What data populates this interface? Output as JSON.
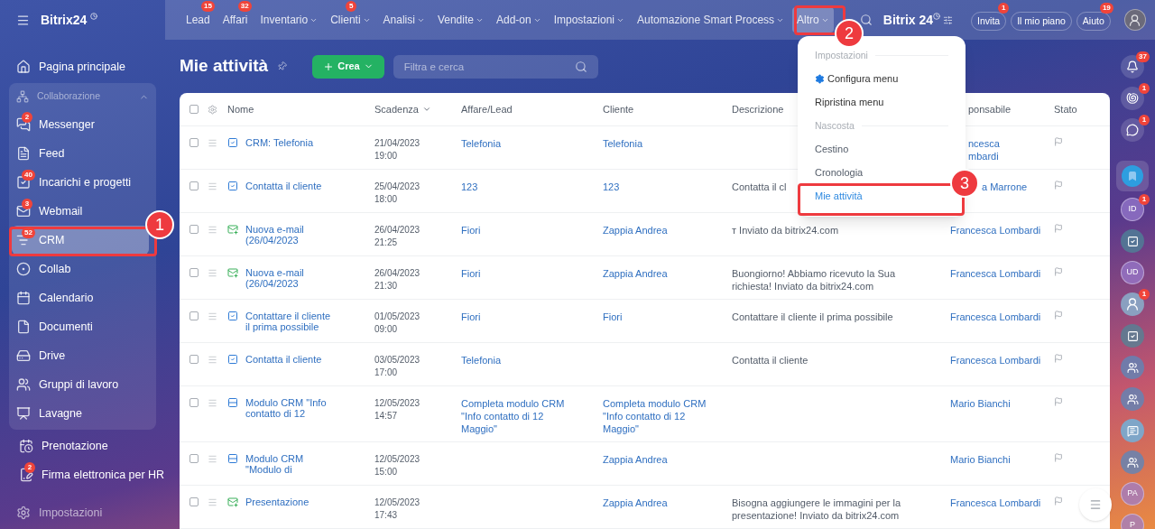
{
  "logo": "Bitrix24",
  "top_nav": [
    {
      "label": "Lead",
      "badge": "15",
      "dropdown": false,
      "selected": false
    },
    {
      "label": "Affari",
      "badge": "32",
      "dropdown": false,
      "selected": false
    },
    {
      "label": "Inventario",
      "dropdown": true,
      "selected": false
    },
    {
      "label": "Clienti",
      "badge": "5",
      "dropdown": true,
      "selected": false
    },
    {
      "label": "Analisi",
      "dropdown": true,
      "selected": false
    },
    {
      "label": "Vendite",
      "dropdown": true,
      "selected": false
    },
    {
      "label": "Add-on",
      "dropdown": true,
      "selected": false
    },
    {
      "label": "Impostazioni",
      "dropdown": true,
      "selected": false
    },
    {
      "label": "Automazione Smart Process",
      "dropdown": true,
      "selected": false
    },
    {
      "label": "Altro",
      "dropdown": true,
      "selected": true
    }
  ],
  "header_right": {
    "brand": "Bitrix 24",
    "buttons": [
      {
        "label": "Invita",
        "badge": "1"
      },
      {
        "label": "Il mio piano"
      },
      {
        "label": "Aiuto",
        "badge": "19"
      }
    ]
  },
  "sidebar": {
    "top_item": "Pagina principale",
    "group": {
      "label": "Collaborazione",
      "expanded": true,
      "items": [
        {
          "label": "Messenger",
          "badge": "2",
          "selected": false
        },
        {
          "label": "Feed",
          "selected": false
        },
        {
          "label": "Incarichi e progetti",
          "badge": "40",
          "selected": false
        },
        {
          "label": "Webmail",
          "badge": "3",
          "selected": false
        },
        {
          "label": "CRM",
          "badge": "52",
          "selected": true
        },
        {
          "label": "Collab",
          "selected": false
        },
        {
          "label": "Calendario",
          "selected": false
        },
        {
          "label": "Documenti",
          "selected": false
        },
        {
          "label": "Drive",
          "selected": false
        },
        {
          "label": "Gruppi di lavoro",
          "selected": false
        },
        {
          "label": "Lavagne",
          "selected": false
        }
      ]
    },
    "items": [
      {
        "label": "Prenotazione"
      },
      {
        "label": "Firma elettronica per HR",
        "badge": "2"
      }
    ],
    "settings": "Impostazioni"
  },
  "page": {
    "title": "Mie attività",
    "create_button": "Crea",
    "search": {
      "placeholder": "Filtra e cerca"
    }
  },
  "table": {
    "select_all": {
      "checked": false
    },
    "columns": [
      "Nome",
      "Scadenza",
      "Affare/Lead",
      "Cliente",
      "Descrizione",
      "ponsabile",
      "Stato"
    ],
    "rows": [
      {
        "kind": "task",
        "checked": false,
        "name": "CRM: Telefonia",
        "date": "21/04/2023",
        "time": "19:00",
        "deal": "Telefonia",
        "client": "Telefonia",
        "responsible": [
          "ncesca",
          "mbardi"
        ]
      },
      {
        "kind": "task",
        "checked": false,
        "name": "Contatta il cliente",
        "date": "25/04/2023",
        "time": "18:00",
        "deal": "123",
        "client": "123",
        "description": "Contatta il cl",
        "responsible": [
          "a Marrone"
        ]
      },
      {
        "kind": "email",
        "checked": false,
        "name": "Nuova e-mail (26/04/2023",
        "date": "26/04/2023",
        "time": "21:25",
        "deal": "Fiori",
        "client": "Zappia Andrea",
        "description": "т Inviato da bitrix24.com",
        "responsible": [
          "Francesca Lombardi"
        ]
      },
      {
        "kind": "email",
        "checked": false,
        "name": "Nuova e-mail (26/04/2023",
        "date": "26/04/2023",
        "time": "21:30",
        "deal": "Fiori",
        "client": "Zappia Andrea",
        "description": "Buongiorno! Abbiamo ricevuto la Sua richiesta!  Inviato da bitrix24.com",
        "responsible": [
          "Francesca Lombardi"
        ]
      },
      {
        "kind": "task",
        "checked": false,
        "name": "Contattare il cliente il prima possibile",
        "date": "01/05/2023",
        "time": "09:00",
        "deal": "Fiori",
        "client": "Fiori",
        "description": "Contattare il cliente il prima possibile",
        "responsible": [
          "Francesca Lombardi"
        ]
      },
      {
        "kind": "task",
        "checked": false,
        "name": "Contatta il cliente",
        "date": "03/05/2023",
        "time": "17:00",
        "deal": "Telefonia",
        "description": "Contatta il cliente",
        "responsible": [
          "Francesca Lombardi"
        ]
      },
      {
        "kind": "form",
        "checked": false,
        "name": "Modulo CRM \"Info contatto di 12",
        "date": "12/05/2023",
        "time": "14:57",
        "deal": "Completa modulo CRM \"Info contatto di 12 Maggio\"",
        "client": "Completa modulo CRM \"Info contatto di 12 Maggio\"",
        "responsible": [
          "Mario Bianchi"
        ]
      },
      {
        "kind": "form",
        "checked": false,
        "name": "Modulo CRM \"Modulo di",
        "date": "12/05/2023",
        "time": "15:00",
        "client": "Zappia Andrea",
        "responsible": [
          "Mario Bianchi"
        ]
      },
      {
        "kind": "email",
        "checked": false,
        "name": "Presentazione",
        "date": "12/05/2023",
        "time": "17:43",
        "client": "Zappia Andrea",
        "description": "Bisogna aggiungere le immagini per la presentazione! Inviato da bitrix24.com",
        "responsible": [
          "Francesca Lombardi"
        ]
      }
    ]
  },
  "dropdown": {
    "items": [
      {
        "kind": "section",
        "label": "Impostazioni"
      },
      {
        "kind": "settings",
        "label": "Configura menu"
      },
      {
        "kind": "item",
        "label": "Ripristina menu",
        "selected": false
      },
      {
        "kind": "section",
        "label": "Nascosta"
      },
      {
        "kind": "item",
        "label": "Cestino",
        "selected": false
      },
      {
        "kind": "item",
        "label": "Cronologia",
        "selected": false
      },
      {
        "kind": "item",
        "label": "Mie attività",
        "selected": true
      }
    ]
  },
  "right_rail": [
    {
      "kind": "bell",
      "badge": "37"
    },
    {
      "kind": "spiral",
      "badge": "1"
    },
    {
      "kind": "chat",
      "badge": "1"
    },
    {
      "kind": "bookmark"
    },
    {
      "kind": "initials",
      "label": "ID",
      "badge": "1"
    },
    {
      "kind": "check"
    },
    {
      "kind": "initials",
      "label": "UD"
    },
    {
      "kind": "avatar",
      "badge": "1"
    },
    {
      "kind": "check"
    },
    {
      "kind": "group"
    },
    {
      "kind": "group"
    },
    {
      "kind": "chat2"
    },
    {
      "kind": "group"
    },
    {
      "kind": "initials",
      "label": "PA"
    },
    {
      "kind": "initials",
      "label": "P"
    }
  ],
  "callouts": [
    {
      "label": "1"
    },
    {
      "label": "2"
    },
    {
      "label": "3"
    }
  ]
}
